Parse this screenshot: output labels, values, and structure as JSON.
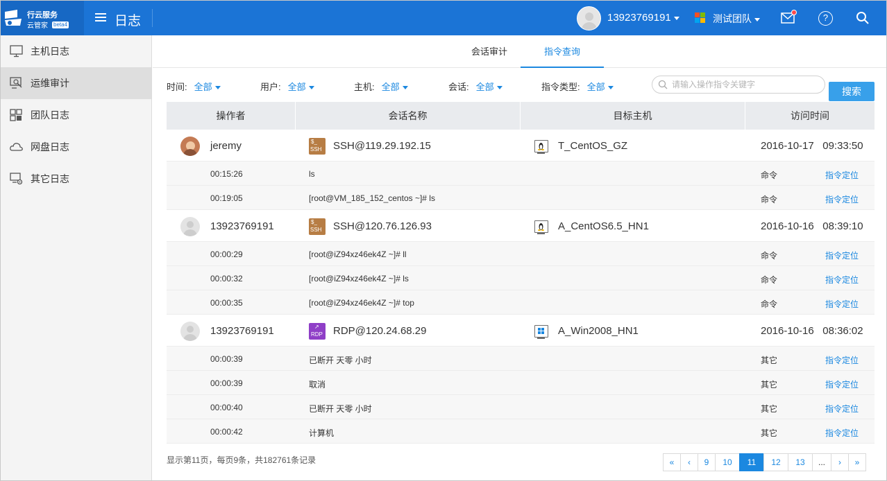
{
  "header": {
    "logo_line1": "行云服务",
    "logo_line2": "云管家",
    "logo_beta": "beta4",
    "title": "日志",
    "user_name": "13923769191",
    "team_name": "测试团队"
  },
  "sidebar": {
    "items": [
      {
        "label": "主机日志",
        "icon": "monitor-icon"
      },
      {
        "label": "运维审计",
        "icon": "audit-icon",
        "active": true
      },
      {
        "label": "团队日志",
        "icon": "grid-icon"
      },
      {
        "label": "网盘日志",
        "icon": "cloud-icon"
      },
      {
        "label": "其它日志",
        "icon": "settings-monitor-icon"
      }
    ]
  },
  "tabs": [
    {
      "label": "会话审计"
    },
    {
      "label": "指令查询",
      "active": true
    }
  ],
  "filters": [
    {
      "label": "时间:",
      "value": "全部"
    },
    {
      "label": "用户:",
      "value": "全部"
    },
    {
      "label": "主机:",
      "value": "全部"
    },
    {
      "label": "会话:",
      "value": "全部"
    },
    {
      "label": "指令类型:",
      "value": "全部"
    }
  ],
  "search": {
    "placeholder": "请输入操作指令关键字",
    "button": "搜索"
  },
  "table": {
    "headers": [
      "操作者",
      "会话名称",
      "目标主机",
      "访问时间"
    ],
    "groups": [
      {
        "operator": "jeremy",
        "avatar": "photo",
        "session_type": "SSH",
        "session": "SSH@119.29.192.15",
        "host_os": "linux",
        "host": "T_CentOS_GZ",
        "time": "2016-10-17   09:33:50",
        "commands": [
          {
            "time": "00:15:26",
            "cmd": "ls",
            "type": "命令",
            "link": "指令定位"
          },
          {
            "time": "00:19:05",
            "cmd": "[root@VM_185_152_centos ~]# ls",
            "type": "命令",
            "link": "指令定位"
          }
        ]
      },
      {
        "operator": "13923769191",
        "avatar": "default",
        "session_type": "SSH",
        "session": "SSH@120.76.126.93",
        "host_os": "linux",
        "host": "A_CentOS6.5_HN1",
        "time": "2016-10-16   08:39:10",
        "commands": [
          {
            "time": "00:00:29",
            "cmd": "[root@iZ94xz46ek4Z ~]# ll",
            "type": "命令",
            "link": "指令定位"
          },
          {
            "time": "00:00:32",
            "cmd": "[root@iZ94xz46ek4Z ~]# ls",
            "type": "命令",
            "link": "指令定位"
          },
          {
            "time": "00:00:35",
            "cmd": "[root@iZ94xz46ek4Z ~]# top",
            "type": "命令",
            "link": "指令定位"
          }
        ]
      },
      {
        "operator": "13923769191",
        "avatar": "default",
        "session_type": "RDP",
        "session": "RDP@120.24.68.29",
        "host_os": "windows",
        "host": "A_Win2008_HN1",
        "time": "2016-10-16   08:36:02",
        "commands": [
          {
            "time": "00:00:39",
            "cmd": "已断开 天零 小时",
            "type": "其它",
            "link": "指令定位"
          },
          {
            "time": "00:00:39",
            "cmd": "取消",
            "type": "其它",
            "link": "指令定位"
          },
          {
            "time": "00:00:40",
            "cmd": "已断开 天零 小时",
            "type": "其它",
            "link": "指令定位"
          },
          {
            "time": "00:00:42",
            "cmd": "计算机",
            "type": "其它",
            "link": "指令定位"
          }
        ]
      }
    ]
  },
  "footer": {
    "info": "显示第11页，每页9条，共182761条记录",
    "pages": [
      "«",
      "‹",
      "9",
      "10",
      "11",
      "12",
      "13",
      "...",
      "›",
      "»"
    ],
    "current_page": "11"
  },
  "colors": {
    "topbar": "#1b74d6",
    "accent": "#1b88e0",
    "search_button": "#38a0ea",
    "ssh_icon": "#b77d44",
    "rdp_icon": "#8f3fc7"
  }
}
